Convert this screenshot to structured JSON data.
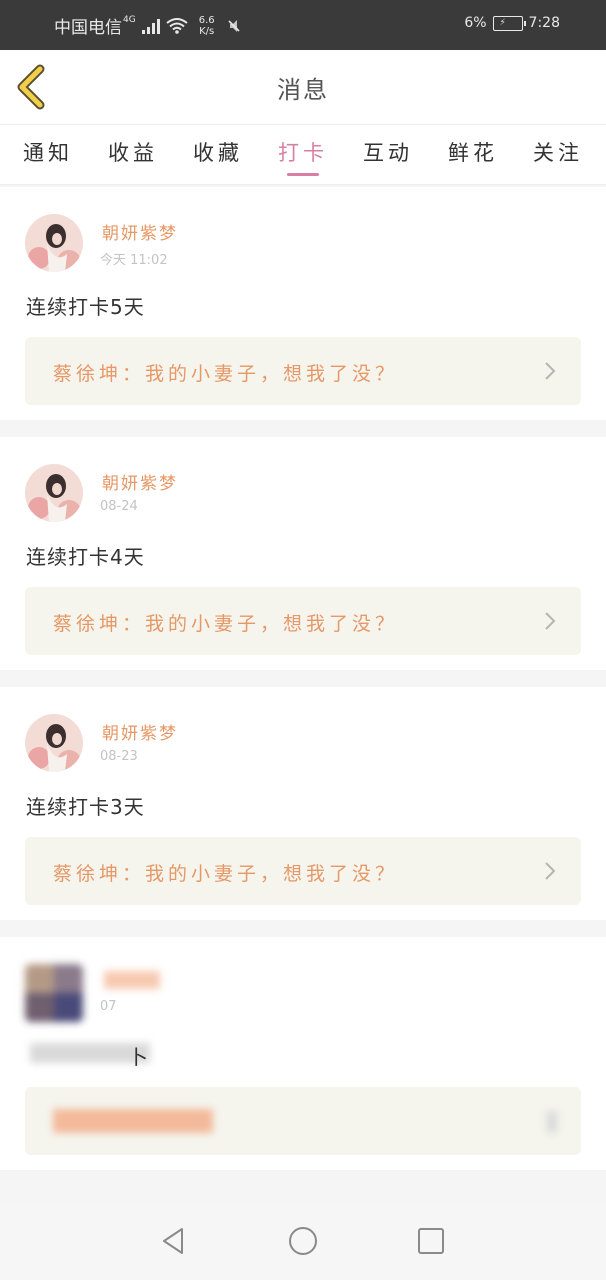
{
  "status_bar": {
    "carrier": "中国电信",
    "network": "4G",
    "speed_value": "6.6",
    "speed_unit": "K/s",
    "battery": "6%",
    "time": "7:28"
  },
  "header": {
    "title": "消息"
  },
  "tabs": [
    "通知",
    "收益",
    "收藏",
    "打卡",
    "互动",
    "鲜花",
    "关注"
  ],
  "active_tab": "打卡",
  "accent_color": "#d97fa6",
  "name_color": "#e69867",
  "cards": [
    {
      "author": "朝妍紫梦",
      "time": "今天 11:02",
      "message": "连续打卡5天",
      "quote": "蔡徐坤：我的小妻子，想我了没？"
    },
    {
      "author": "朝妍紫梦",
      "time": "08-24",
      "message": "连续打卡4天",
      "quote": "蔡徐坤：我的小妻子，想我了没？"
    },
    {
      "author": "朝妍紫梦",
      "time": "08-23",
      "message": "连续打卡3天",
      "quote": "蔡徐坤：我的小妻子，想我了没？"
    },
    {
      "time": "07",
      "message": "卜"
    }
  ],
  "icons": {
    "back": "chevron-left-icon",
    "quote_arrow": "chevron-right-icon",
    "nav_back": "triangle-back-icon",
    "nav_home": "circle-home-icon",
    "nav_recent": "square-recent-icon"
  }
}
